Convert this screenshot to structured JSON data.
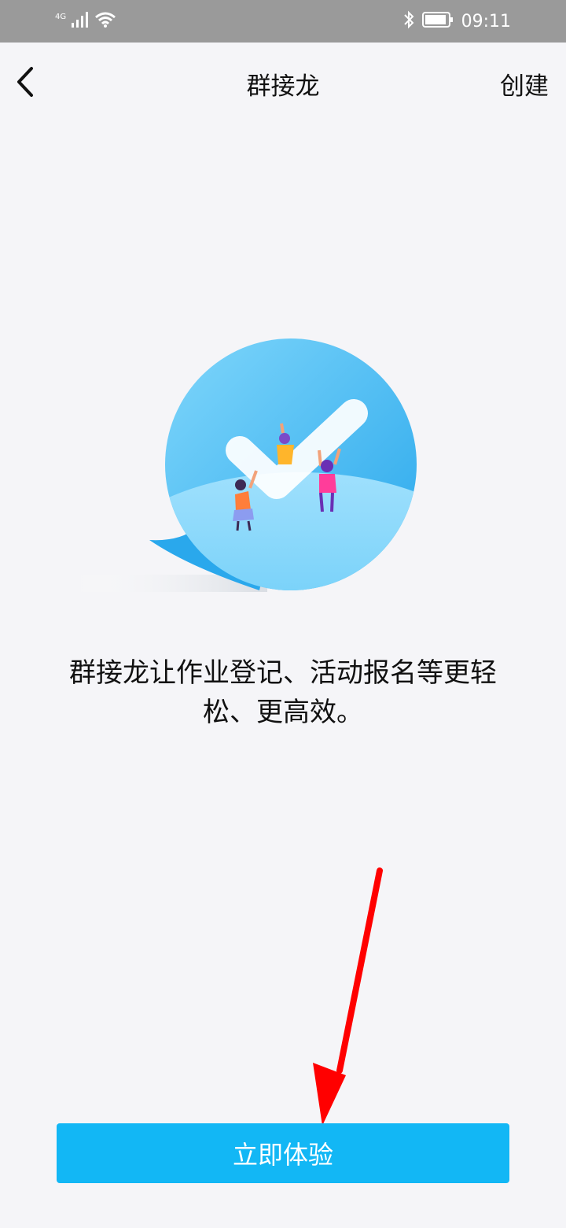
{
  "status_bar": {
    "network": "4G",
    "time": "09:11",
    "icons": [
      "signal-icon",
      "wifi-icon",
      "bluetooth-icon",
      "battery-icon"
    ]
  },
  "nav": {
    "back_icon": "chevron-left-icon",
    "title": "群接龙",
    "create_label": "创建"
  },
  "content": {
    "description_line1": "群接龙让作业登记、活动报名等更轻",
    "description_line2": "松、更高效。"
  },
  "cta": {
    "label": "立即体验"
  },
  "colors": {
    "accent": "#12b7f5",
    "annotation_arrow": "#ff0000",
    "background": "#f5f5f8",
    "status_bar": "#9a9a9a"
  }
}
